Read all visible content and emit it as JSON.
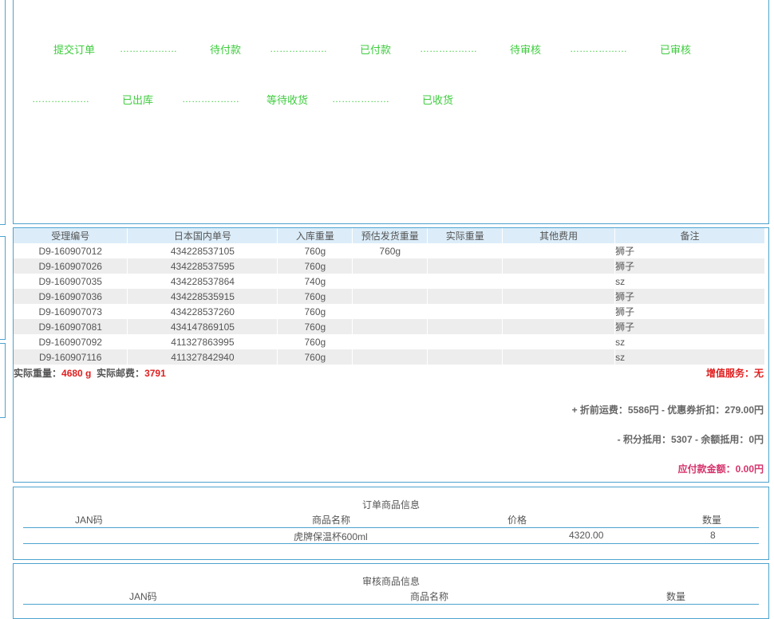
{
  "status_flow": {
    "steps": [
      "提交订单",
      "待付款",
      "已付款",
      "待审核",
      "已审核",
      "已出库",
      "等待收货",
      "已收货"
    ],
    "dots": "………………"
  },
  "records_table": {
    "headers": [
      "受理编号",
      "日本国内单号",
      "入库重量",
      "预估发货重量",
      "实际重量",
      "其他费用",
      "备注"
    ],
    "rows": [
      [
        "D9-160907012",
        "434228537105",
        "760g",
        "760g",
        "",
        "",
        "狮子"
      ],
      [
        "D9-160907026",
        "434228537595",
        "760g",
        "",
        "",
        "",
        "狮子"
      ],
      [
        "D9-160907035",
        "434228537864",
        "740g",
        "",
        "",
        "",
        "sz"
      ],
      [
        "D9-160907036",
        "434228535915",
        "760g",
        "",
        "",
        "",
        "狮子"
      ],
      [
        "D9-160907073",
        "434228537260",
        "760g",
        "",
        "",
        "",
        "狮子"
      ],
      [
        "D9-160907081",
        "434147869105",
        "760g",
        "",
        "",
        "",
        "狮子"
      ],
      [
        "D9-160907092",
        "411327863995",
        "760g",
        "",
        "",
        "",
        "sz"
      ],
      [
        "D9-160907116",
        "411327842940",
        "760g",
        "",
        "",
        "",
        "sz"
      ]
    ]
  },
  "summary": {
    "weight_label": "实际重量：",
    "weight_value": "4680 g",
    "postage_label": "实际邮费：",
    "postage_value": "3791",
    "value_added": "增值服务：无",
    "fee_line1": "+ 折前运费：5586円 - 优惠券折扣：279.00円",
    "fee_line2": "- 积分抵用：5307 - 余额抵用：0円",
    "payable": "应付款金额：0.00円"
  },
  "order_goods": {
    "title": "订单商品信息",
    "headers": [
      "JAN码",
      "商品名称",
      "价格",
      "数量"
    ],
    "rows": [
      {
        "jan": "",
        "name": "虎牌保温杯600ml",
        "price": "4320.00",
        "qty": "8"
      }
    ]
  },
  "audit_goods": {
    "title": "审核商品信息",
    "headers": [
      "JAN码",
      "商品名称",
      "数量"
    ]
  },
  "colors": {
    "accent_border": "#4da3cf",
    "status_green": "#3dcc3d",
    "header_bg": "#dcedf9",
    "alt_row_bg": "#ededed",
    "warn_red": "#e02020",
    "payable_pink": "#d6336c"
  }
}
